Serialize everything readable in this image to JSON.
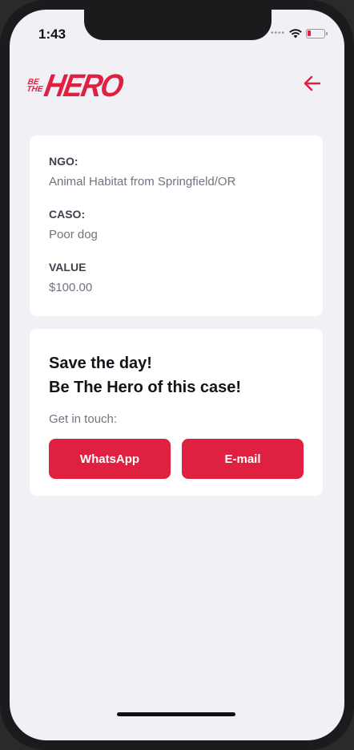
{
  "status_bar": {
    "time": "1:43",
    "signal_icon": "signal-dots-icon",
    "wifi_icon": "wifi-icon",
    "battery_icon": "battery-low-icon"
  },
  "header": {
    "logo_small_line1": "BE",
    "logo_small_line2": "THE",
    "logo_big": "HERO",
    "back_icon": "arrow-left-icon"
  },
  "incident": {
    "ngo_label": "NGO:",
    "ngo_value": "Animal Habitat from Springfield/OR",
    "case_label": "CASO:",
    "case_value": "Poor dog",
    "value_label": "VALUE",
    "value_value": "$100.00"
  },
  "contact": {
    "title_line1": "Save the day!",
    "title_line2": "Be The Hero of this case!",
    "description": "Get in touch:",
    "whatsapp_label": "WhatsApp",
    "email_label": "E-mail"
  },
  "colors": {
    "brand": "#e02041",
    "background": "#f0f0f5",
    "card": "#ffffff",
    "label": "#41414d",
    "value": "#737380"
  }
}
